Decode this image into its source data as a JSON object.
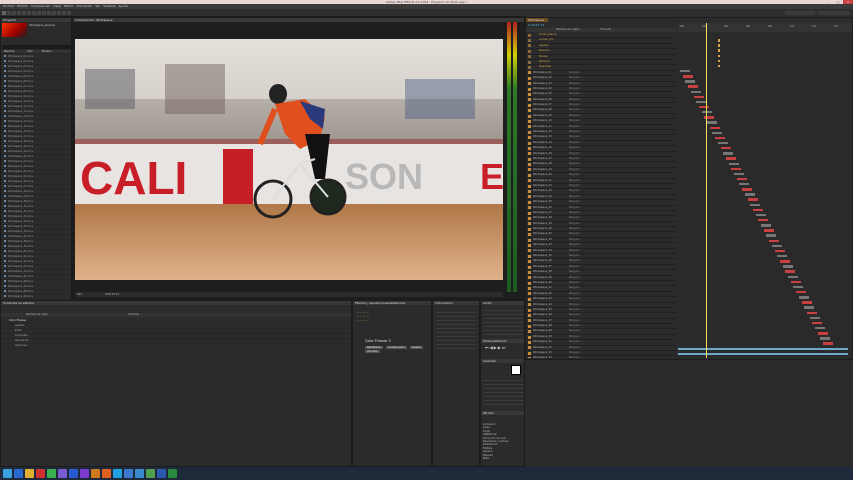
{
  "window": {
    "title": "Adobe After Effects CC 2014 - Proyecto sin título.aep *"
  },
  "menu": [
    "Archivo",
    "Edición",
    "Composición",
    "Capa",
    "Efecto",
    "Animación",
    "Ver",
    "Ventana",
    "Ayuda"
  ],
  "project_panel": {
    "tab": "Proyecto",
    "selected_info": "Workspace_Ascenso",
    "search_placeholder": "",
    "columns": [
      "Nombre",
      "Tipo",
      "Tamaño"
    ],
    "items": [
      "Workspace_01.mov",
      "Workspace_02.mov",
      "Workspace_03.mov",
      "Workspace_04.mov",
      "Workspace_05.mov",
      "Workspace_06.mov",
      "Workspace_07.mov",
      "Workspace_08.mov",
      "Workspace_09.mov",
      "Workspace_10.mov",
      "Workspace_11.mov",
      "Workspace_12.mov",
      "Workspace_13.mov",
      "Workspace_14.mov",
      "Workspace_15.mov",
      "Workspace_16.mov",
      "Workspace_17.mov",
      "Workspace_18.mov",
      "Workspace_19.mov",
      "Workspace_20.mov",
      "Workspace_21.mov",
      "Workspace_22.mov",
      "Workspace_23.mov",
      "Workspace_24.mov",
      "Workspace_25.mov",
      "Workspace_26.mov",
      "Workspace_27.mov",
      "Workspace_28.mov",
      "Workspace_29.mov",
      "Workspace_30.mov",
      "Workspace_31.mov",
      "Workspace_32.mov",
      "Workspace_33.mov",
      "Workspace_34.mov",
      "Workspace_35.mov",
      "Workspace_36.mov",
      "Workspace_37.mov",
      "Workspace_38.mov",
      "Workspace_39.mov",
      "Workspace_40.mov",
      "Workspace_41.mov",
      "Workspace_42.mov",
      "Workspace_43.mov",
      "Workspace_44.mov",
      "Workspace_45.mov",
      "Workspace_46.mov",
      "Workspace_47.mov",
      "Workspace_48.mov",
      "Workspace_49.mov",
      "Workspace_50.mov",
      "Workspace_51.mov",
      "Workspace_52.mov",
      "Workspace_53.mov",
      "Workspace_54.mov"
    ],
    "selected_index": 52
  },
  "viewer": {
    "tab": "Composición: Workspace",
    "zoom": "50%",
    "timecode": "0;00;07;12",
    "banner_text": "CALI",
    "banner_text2": "SON",
    "banner_text3": "E"
  },
  "timeline": {
    "tab": "Workspace",
    "timecode": "0;00;07;12",
    "header_cols": [
      "Nombre de origen",
      "Primario"
    ],
    "ruler": [
      "00s",
      "02s",
      "04s",
      "06s",
      "08s",
      "10s",
      "12s",
      "14s"
    ],
    "layers": [
      "Fondo_blanco",
      "Animar_01",
      "Ajustes",
      "Posición",
      "Escala",
      "Rotación",
      "Opacidad",
      "Workspace_01",
      "Workspace_02",
      "Workspace_03",
      "Workspace_04",
      "Workspace_05",
      "Workspace_06",
      "Workspace_07",
      "Workspace_08",
      "Workspace_09",
      "Workspace_10",
      "Workspace_11",
      "Workspace_12",
      "Workspace_13",
      "Workspace_14",
      "Workspace_15",
      "Workspace_16",
      "Workspace_17",
      "Workspace_18",
      "Workspace_19",
      "Workspace_20",
      "Workspace_21",
      "Workspace_22",
      "Workspace_23",
      "Workspace_24",
      "Workspace_25",
      "Workspace_26",
      "Workspace_27",
      "Workspace_28",
      "Workspace_29",
      "Workspace_30",
      "Workspace_31",
      "Workspace_32",
      "Workspace_33",
      "Workspace_34",
      "Workspace_35",
      "Workspace_36",
      "Workspace_37",
      "Workspace_38",
      "Workspace_39",
      "Workspace_40",
      "Workspace_41",
      "Workspace_42",
      "Workspace_43",
      "Workspace_44",
      "Workspace_45",
      "Workspace_46",
      "Workspace_47",
      "Workspace_48",
      "Workspace_49",
      "Workspace_50",
      "Workspace_51",
      "Workspace_52",
      "Workspace_53",
      "Workspace_54",
      "Fondo_Workspace",
      "Text_Ending"
    ],
    "parent_value": "Ninguno"
  },
  "bottom_left_panel": {
    "tab": "Controles de efectos",
    "col1": "Nombre de capa",
    "col2": "Primario",
    "rows": [
      "Color Finesse",
      "Ajustes",
      "Brillo",
      "Contraste",
      "Saturación",
      "Opciones"
    ]
  },
  "effects_panel": {
    "tab": "Efectos y ajustes preestablecidos",
    "title": "Color Finesse 3",
    "buttons": [
      "Restablecer",
      "Configuración",
      "Aceptar",
      "Cancelar"
    ]
  },
  "right_panels": {
    "info_tab": "Información",
    "audio_tab": "Audio",
    "preview_tab": "Previsualización",
    "character_tab": "Carácter",
    "paragraph_tab": "Párrafo",
    "presets": [
      "Animación",
      "Audio",
      "Canal",
      "CINEMA 4D",
      "Corrección de color",
      "Desenfocar y enfocar",
      "Distorsionar",
      "Estilizar",
      "Generar",
      "Máscara",
      "Mate"
    ]
  },
  "colors": {
    "accent": "#d4a54a",
    "label": "#c98f3a",
    "playhead": "#f0e060",
    "bar_red": "#c84040",
    "bar_blue": "#6fa9c9"
  },
  "taskbar": {
    "icons": [
      "windows-start-icon",
      "ie-icon",
      "folder-icon",
      "media-icon",
      "chrome-icon",
      "ae-icon",
      "ps-icon",
      "pr-icon",
      "illustrator-icon",
      "firefox-icon",
      "skype-icon",
      "lr-icon",
      "mail-icon",
      "store-icon",
      "word-icon",
      "excel-icon"
    ]
  }
}
